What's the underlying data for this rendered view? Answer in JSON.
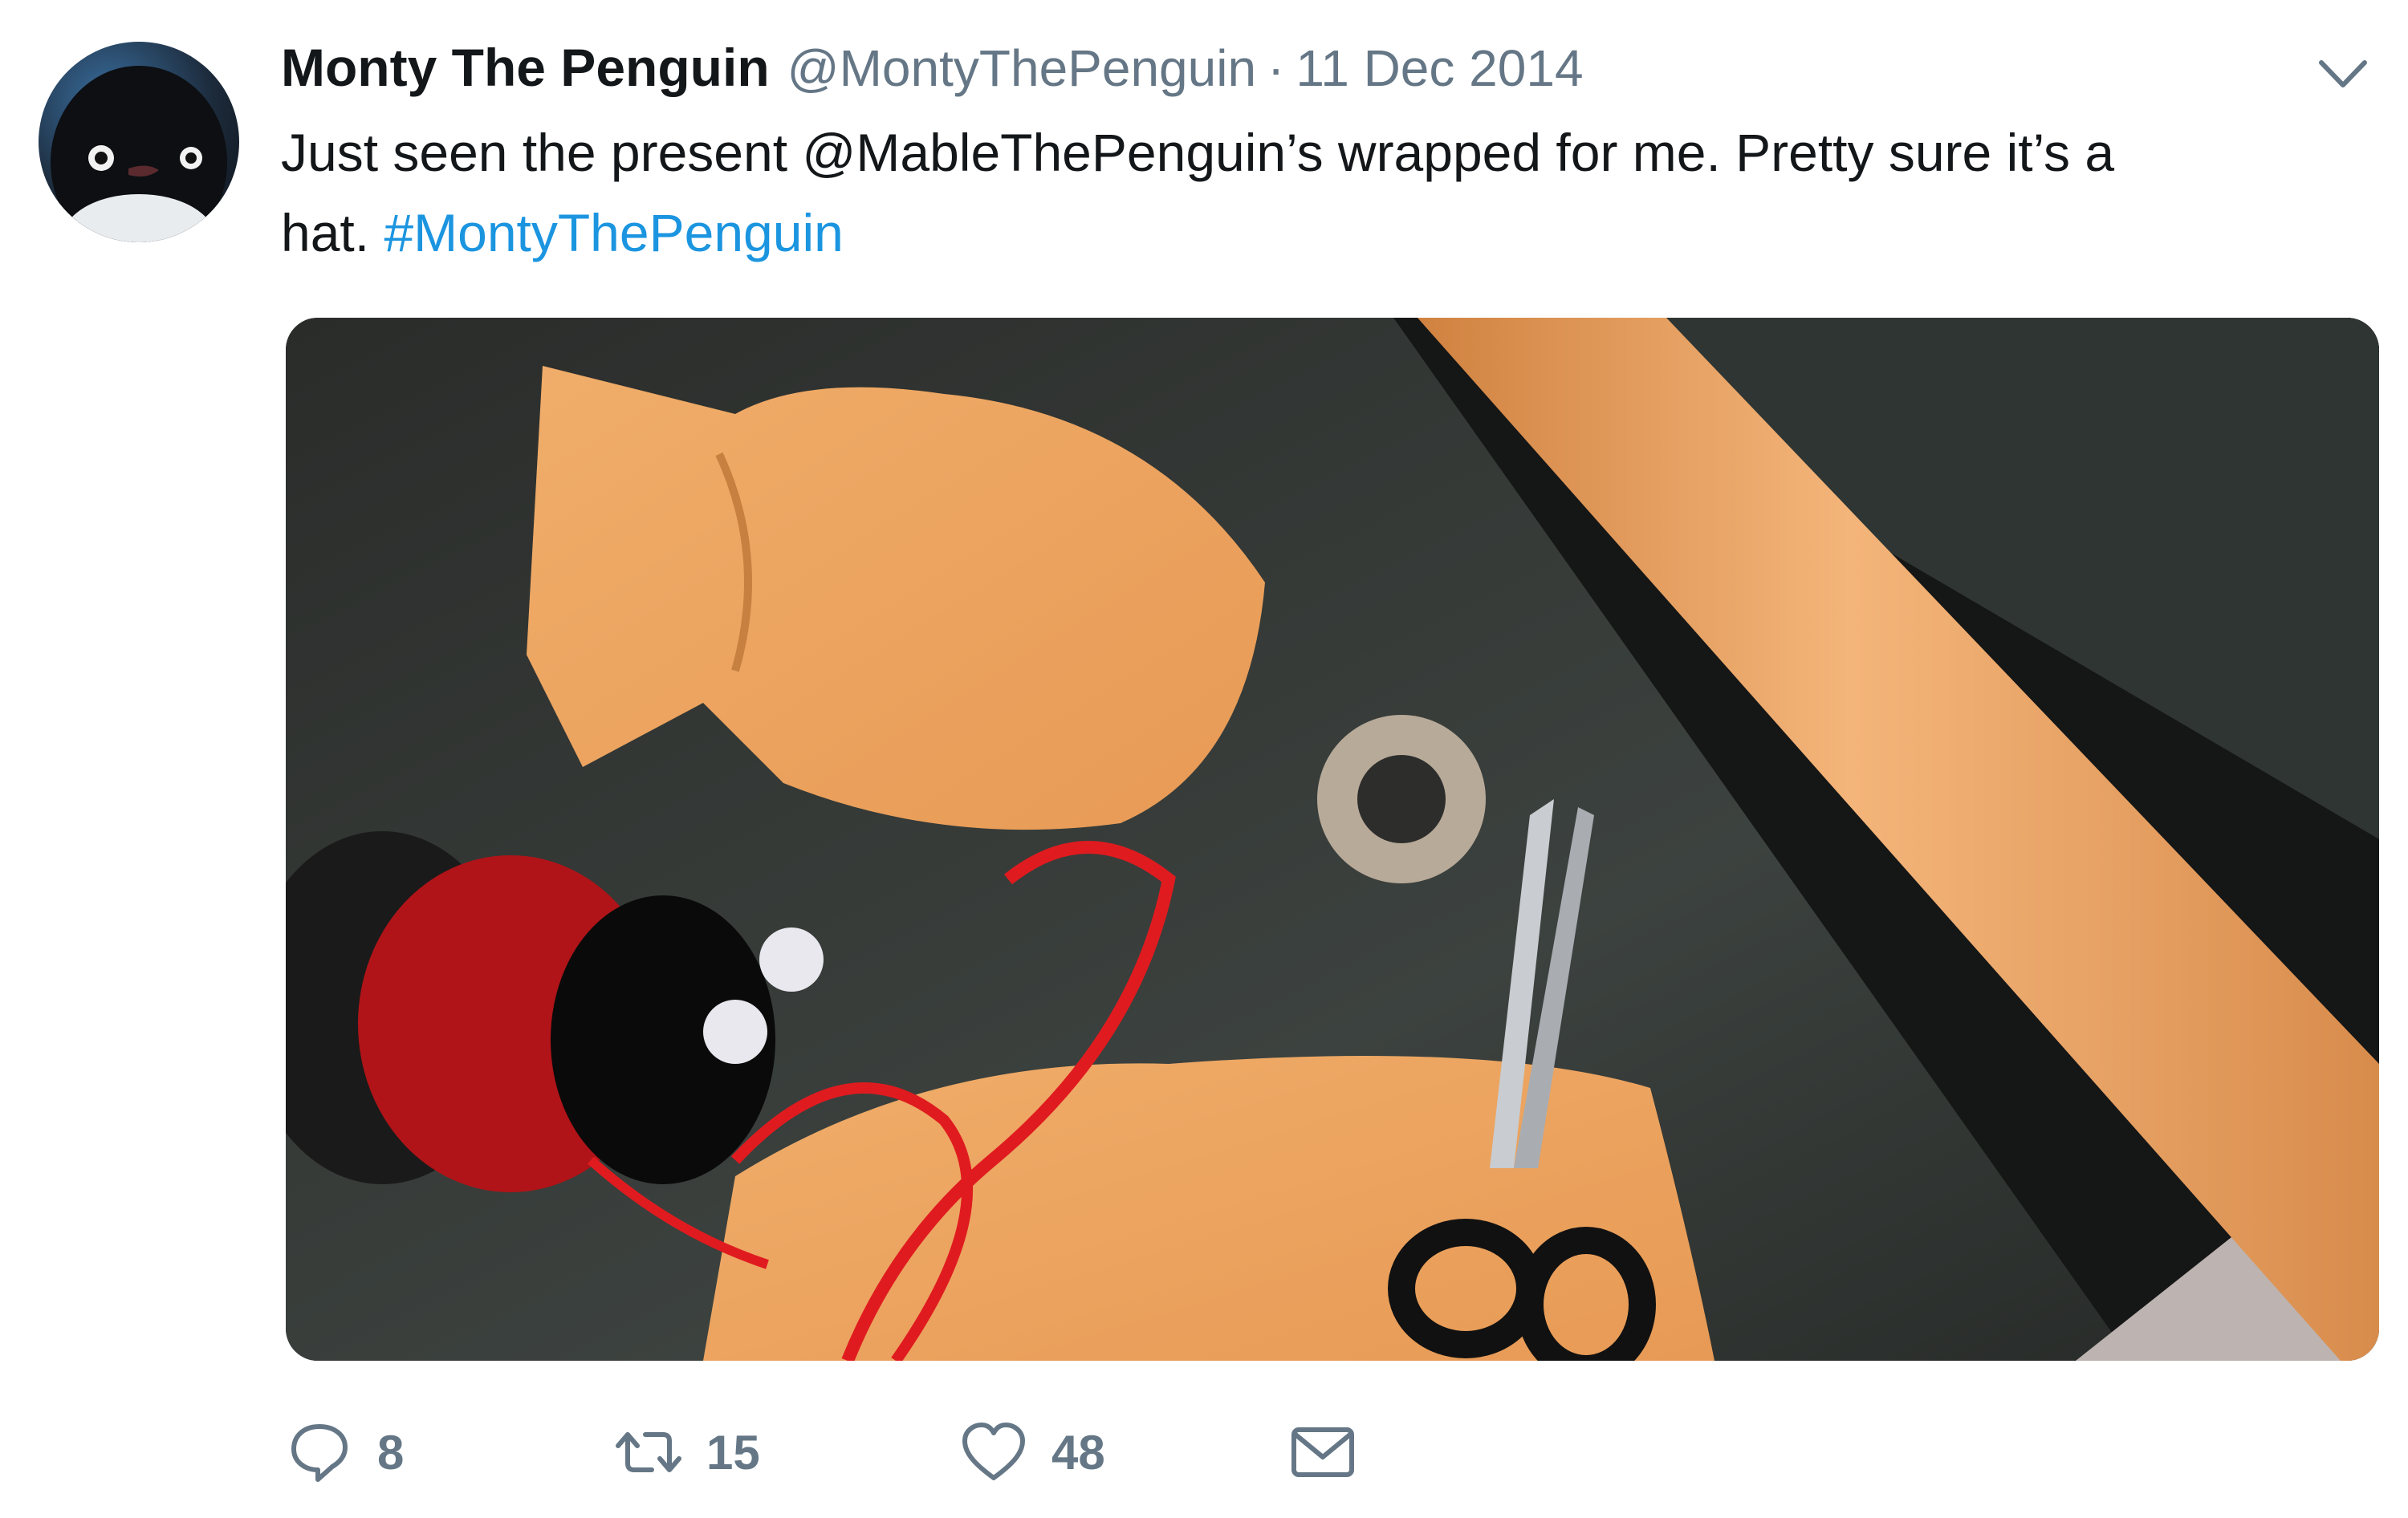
{
  "tweet": {
    "display_name": "Monty The Penguin",
    "handle": "@MontyThePenguin",
    "separator": "·",
    "date": "11 Dec 2014",
    "text_line1": "Just seen the present @MableThePenguin’s wrapped for me. Pretty sure it’s a",
    "text_line2_prefix": "hat.",
    "hashtag": "#MontyThePenguin"
  },
  "media": {
    "description_icon": "photo-wrapping-paper"
  },
  "actions": {
    "reply": {
      "icon": "reply-icon",
      "count": "8"
    },
    "retweet": {
      "icon": "retweet-icon",
      "count": "15"
    },
    "like": {
      "icon": "heart-icon",
      "count": "48"
    },
    "dm": {
      "icon": "envelope-icon"
    }
  },
  "colors": {
    "text": "#14171a",
    "secondary": "#657786",
    "link": "#1b95e0"
  }
}
